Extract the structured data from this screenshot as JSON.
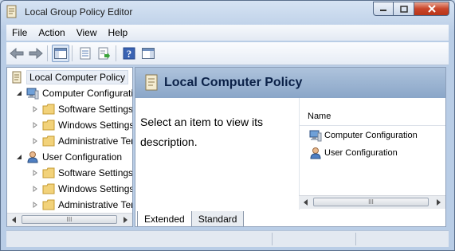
{
  "window": {
    "title": "Local Group Policy Editor",
    "icon": "policy-editor-icon",
    "accent_color": "#c9452a"
  },
  "menubar": {
    "items": [
      "File",
      "Action",
      "View",
      "Help"
    ]
  },
  "toolbar": {
    "buttons": [
      "back-arrow-icon",
      "forward-arrow-icon",
      "show-hide-tree-icon",
      "properties-icon",
      "export-list-icon",
      "help-icon",
      "show-action-pane-icon"
    ]
  },
  "tree": {
    "root_label": "Local Computer Policy",
    "items": [
      {
        "label": "Computer Configuratio",
        "level": 1
      },
      {
        "label": "Software Settings",
        "level": 2
      },
      {
        "label": "Windows Settings",
        "level": 2
      },
      {
        "label": "Administrative Tem",
        "level": 2
      },
      {
        "label": "User Configuration",
        "level": 1
      },
      {
        "label": "Software Settings",
        "level": 2
      },
      {
        "label": "Windows Settings",
        "level": 2
      },
      {
        "label": "Administrative Tem",
        "level": 2
      }
    ],
    "scroll_thumb": "III"
  },
  "right": {
    "header_title": "Local Computer Policy",
    "description": "Select an item to view its description.",
    "column_header": "Name",
    "list_items": [
      "Computer Configuration",
      "User Configuration"
    ],
    "scroll_thumb": "III",
    "tabs": [
      "Extended",
      "Standard"
    ],
    "active_tab": "Extended"
  }
}
